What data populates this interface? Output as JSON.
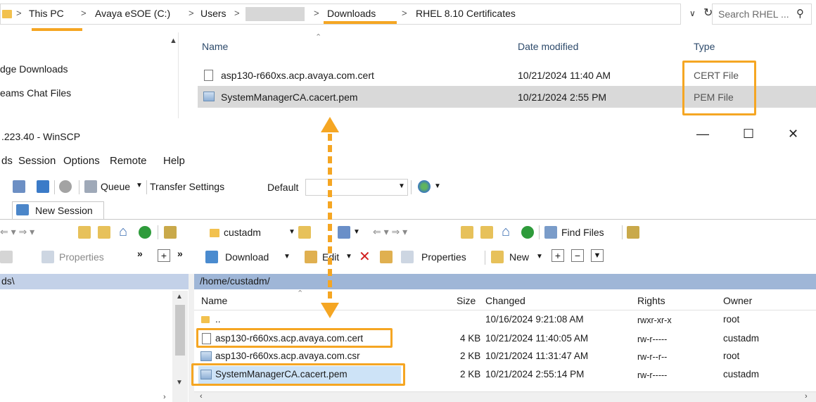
{
  "explorer": {
    "address": {
      "segments": [
        "This PC",
        "Avaya eSOE (C:)",
        "Users",
        "Downloads",
        "RHEL 8.10 Certificates"
      ],
      "separator": ">"
    },
    "search_placeholder": "Search RHEL ...",
    "columns": {
      "name": "Name",
      "date": "Date modified",
      "type": "Type"
    },
    "sidebar": [
      "dge Downloads",
      "eams Chat Files"
    ],
    "files": [
      {
        "name": "asp130-r660xs.acp.avaya.com.cert",
        "date": "10/21/2024 11:40 AM",
        "type": "CERT File"
      },
      {
        "name": "SystemManagerCA.cacert.pem",
        "date": "10/21/2024 2:55 PM",
        "type": "PEM File"
      }
    ]
  },
  "winscp": {
    "title": ".223.40 - WinSCP",
    "controls": {
      "minimize": "—",
      "maximize": "☐",
      "close": "✕"
    },
    "menu": [
      "ds",
      "Session",
      "Options",
      "Remote",
      "Help"
    ],
    "toolbar1": {
      "queue": "Queue",
      "transfer_label": "Transfer Settings",
      "transfer_value": "Default"
    },
    "tab": "New Session",
    "remote_toolbar": {
      "folder": "custadm",
      "find_files": "Find Files"
    },
    "left_actions": {
      "properties": "Properties"
    },
    "remote_actions": {
      "download": "Download",
      "edit": "Edit",
      "properties": "Properties",
      "new": "New"
    },
    "left_path": "ds\\",
    "remote_path": "/home/custadm/",
    "columns": {
      "name": "Name",
      "size": "Size",
      "changed": "Changed",
      "rights": "Rights",
      "owner": "Owner"
    },
    "files": [
      {
        "name": "..",
        "size": "",
        "changed": "10/16/2024 9:21:08 AM",
        "rights": "rwxr-xr-x",
        "owner": "root"
      },
      {
        "name": "asp130-r660xs.acp.avaya.com.cert",
        "size": "4 KB",
        "changed": "10/21/2024 11:40:05 AM",
        "rights": "rw-r-----",
        "owner": "custadm"
      },
      {
        "name": "asp130-r660xs.acp.avaya.com.csr",
        "size": "2 KB",
        "changed": "10/21/2024 11:31:47 AM",
        "rights": "rw-r--r--",
        "owner": "root"
      },
      {
        "name": "SystemManagerCA.cacert.pem",
        "size": "2 KB",
        "changed": "10/21/2024 2:55:14 PM",
        "rights": "rw-r-----",
        "owner": "custadm"
      }
    ]
  },
  "colors": {
    "highlight": "#f5a623",
    "selection": "#d9d9d9",
    "path_bar": "#9fb6d7"
  }
}
